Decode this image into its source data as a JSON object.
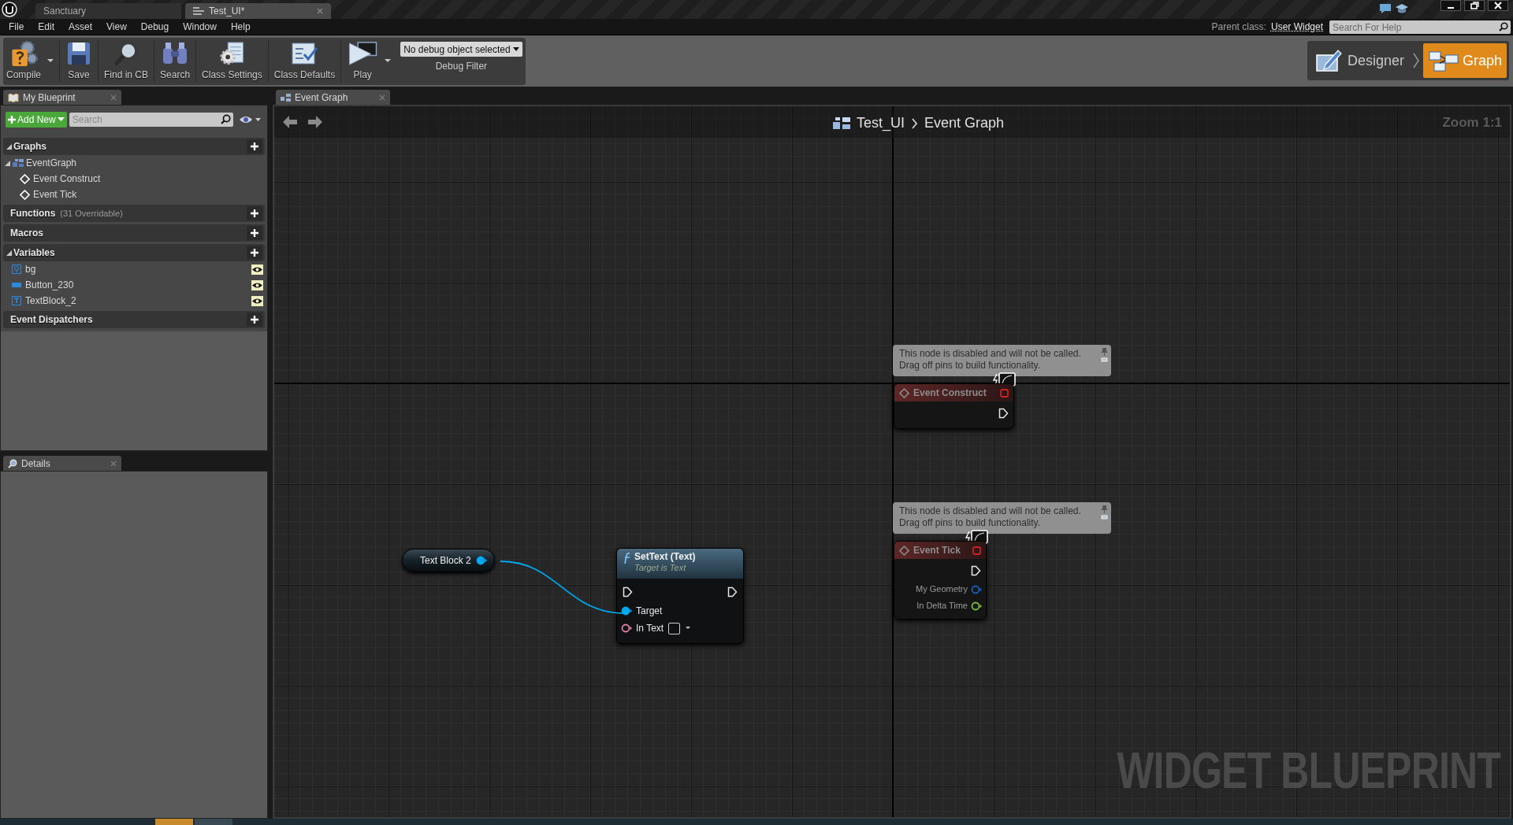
{
  "title_bar": {
    "tabs": [
      {
        "label": "Sanctuary",
        "selected": false
      },
      {
        "label": "Test_UI*",
        "selected": true
      }
    ]
  },
  "menu": [
    "File",
    "Edit",
    "Asset",
    "View",
    "Debug",
    "Window",
    "Help"
  ],
  "parent_class": {
    "label": "Parent class:",
    "value": "User Widget"
  },
  "help_search": {
    "placeholder": "Search For Help"
  },
  "toolbar": {
    "buttons": [
      {
        "label": "Compile",
        "kind": "compile",
        "dropdown": true
      },
      {
        "label": "Save",
        "kind": "save",
        "dropdown": false
      },
      {
        "label": "Find in CB",
        "kind": "find",
        "dropdown": false
      },
      {
        "label": "Search",
        "kind": "search",
        "dropdown": false
      },
      {
        "label": "Class Settings",
        "kind": "settings",
        "dropdown": false
      },
      {
        "label": "Class Defaults",
        "kind": "defaults",
        "dropdown": false
      },
      {
        "label": "Play",
        "kind": "play",
        "dropdown": true
      }
    ],
    "debug_filter": {
      "value": "No debug object selected",
      "label": "Debug Filter"
    }
  },
  "modes": [
    {
      "label": "Designer",
      "kind": "designer",
      "selected": false
    },
    {
      "label": "Graph",
      "kind": "graph",
      "selected": true
    }
  ],
  "my_blueprint": {
    "tab": "My Blueprint",
    "add_new": "Add New",
    "search": {
      "placeholder": "Search"
    },
    "sections": [
      {
        "title": "Graphs",
        "expanded": true,
        "items": [
          {
            "label": "EventGraph",
            "kind": "graph",
            "expanded": true,
            "children": [
              {
                "label": "Event Construct"
              },
              {
                "label": "Event Tick"
              }
            ]
          }
        ]
      },
      {
        "title": "Functions",
        "note": "(31 Overridable)",
        "expanded": false
      },
      {
        "title": "Macros",
        "expanded": false
      },
      {
        "title": "Variables",
        "expanded": true,
        "items": [
          {
            "label": "bg",
            "kind": "image",
            "visible": true
          },
          {
            "label": "Button_230",
            "kind": "button",
            "visible": true
          },
          {
            "label": "TextBlock_2",
            "kind": "text",
            "visible": true
          }
        ]
      },
      {
        "title": "Event Dispatchers",
        "expanded": false
      }
    ]
  },
  "details": {
    "tab": "Details"
  },
  "graph": {
    "tab": "Event Graph",
    "breadcrumb": [
      "Test_UI",
      "Event Graph"
    ],
    "zoom": "Zoom 1:1",
    "watermark": "WIDGET BLUEPRINT",
    "nodes": [
      {
        "kind": "variable",
        "title": "Text Block 2",
        "outputs": [
          {
            "color": "#00a8f0",
            "connected": true
          }
        ]
      },
      {
        "kind": "function",
        "title": "SetText (Text)",
        "subtitle": "Target is Text",
        "exec_in": true,
        "exec_out": true,
        "inputs": [
          {
            "label": "Target",
            "color": "#00a8f0",
            "connected": true,
            "value_box": false
          },
          {
            "label": "In Text",
            "color": "#e27fa6",
            "connected": false,
            "value_box": true
          }
        ]
      },
      {
        "kind": "event",
        "title": "Event Construct",
        "disabled": true,
        "comment": [
          "This node is disabled and will not be called.",
          "Drag off pins to build functionality."
        ],
        "exec_out": true
      },
      {
        "kind": "event",
        "title": "Event Tick",
        "disabled": true,
        "comment": [
          "This node is disabled and will not be called.",
          "Drag off pins to build functionality."
        ],
        "exec_out": true,
        "outputs": [
          {
            "label": "My Geometry",
            "color": "#1560c0",
            "connected": false
          },
          {
            "label": "In Delta Time",
            "color": "#7cbf3a",
            "connected": false
          }
        ]
      }
    ]
  }
}
